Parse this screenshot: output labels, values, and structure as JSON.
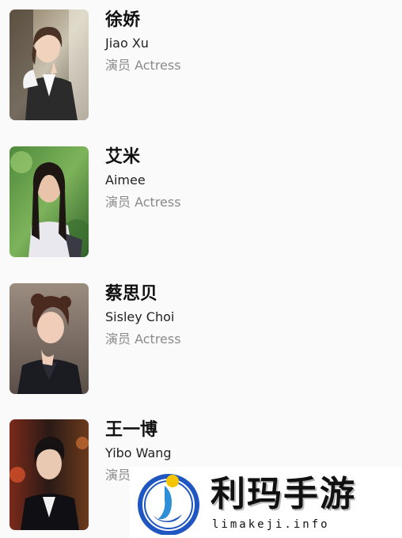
{
  "cast": [
    {
      "name_zh": "徐娇",
      "name_en": "Jiao Xu",
      "role": "演员 Actress"
    },
    {
      "name_zh": "艾米",
      "name_en": "Aimee",
      "role": "演员 Actress"
    },
    {
      "name_zh": "蔡思贝",
      "name_en": "Sisley Choi",
      "role": "演员 Actress"
    },
    {
      "name_zh": "王一博",
      "name_en": "Yibo Wang",
      "role": "演员"
    }
  ],
  "watermark": {
    "title": "利玛手游",
    "domain": "limakeji.info"
  },
  "colors": {
    "background": "#fafafa",
    "role_text": "#8a8a8a",
    "logo_blue": "#1f56c2",
    "logo_yellow": "#f6c400"
  }
}
